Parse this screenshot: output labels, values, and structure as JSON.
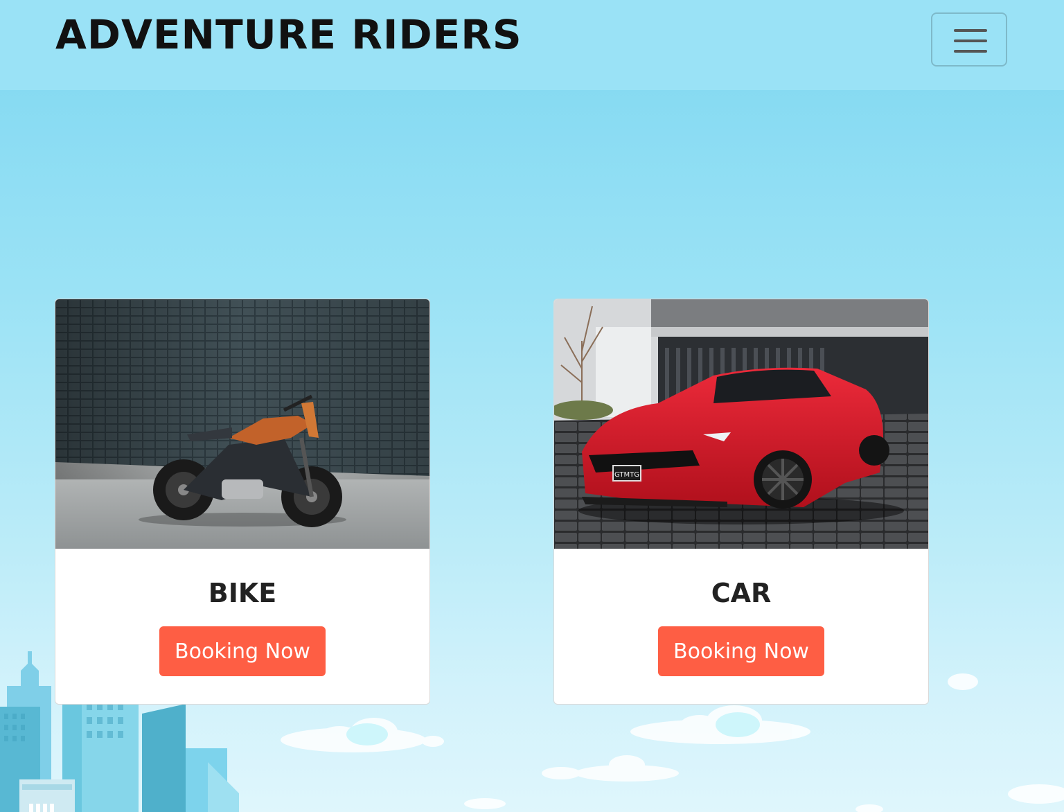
{
  "navbar": {
    "brand": "ADVENTURE RIDERS",
    "toggler_icon": "hamburger-menu-icon"
  },
  "cards": [
    {
      "image": "motorcycle-photo",
      "title": "BIKE",
      "button_label": "Booking Now"
    },
    {
      "image": "red-sports-car-photo",
      "title": "CAR",
      "button_label": "Booking Now"
    }
  ],
  "colors": {
    "sky_top": "#7ed7f1",
    "sky_bottom": "#dff6fc",
    "navbar_bg": "#9ae2f6",
    "button_bg": "#fe5e44",
    "button_text": "#ffffff",
    "brand_text": "#111111"
  }
}
